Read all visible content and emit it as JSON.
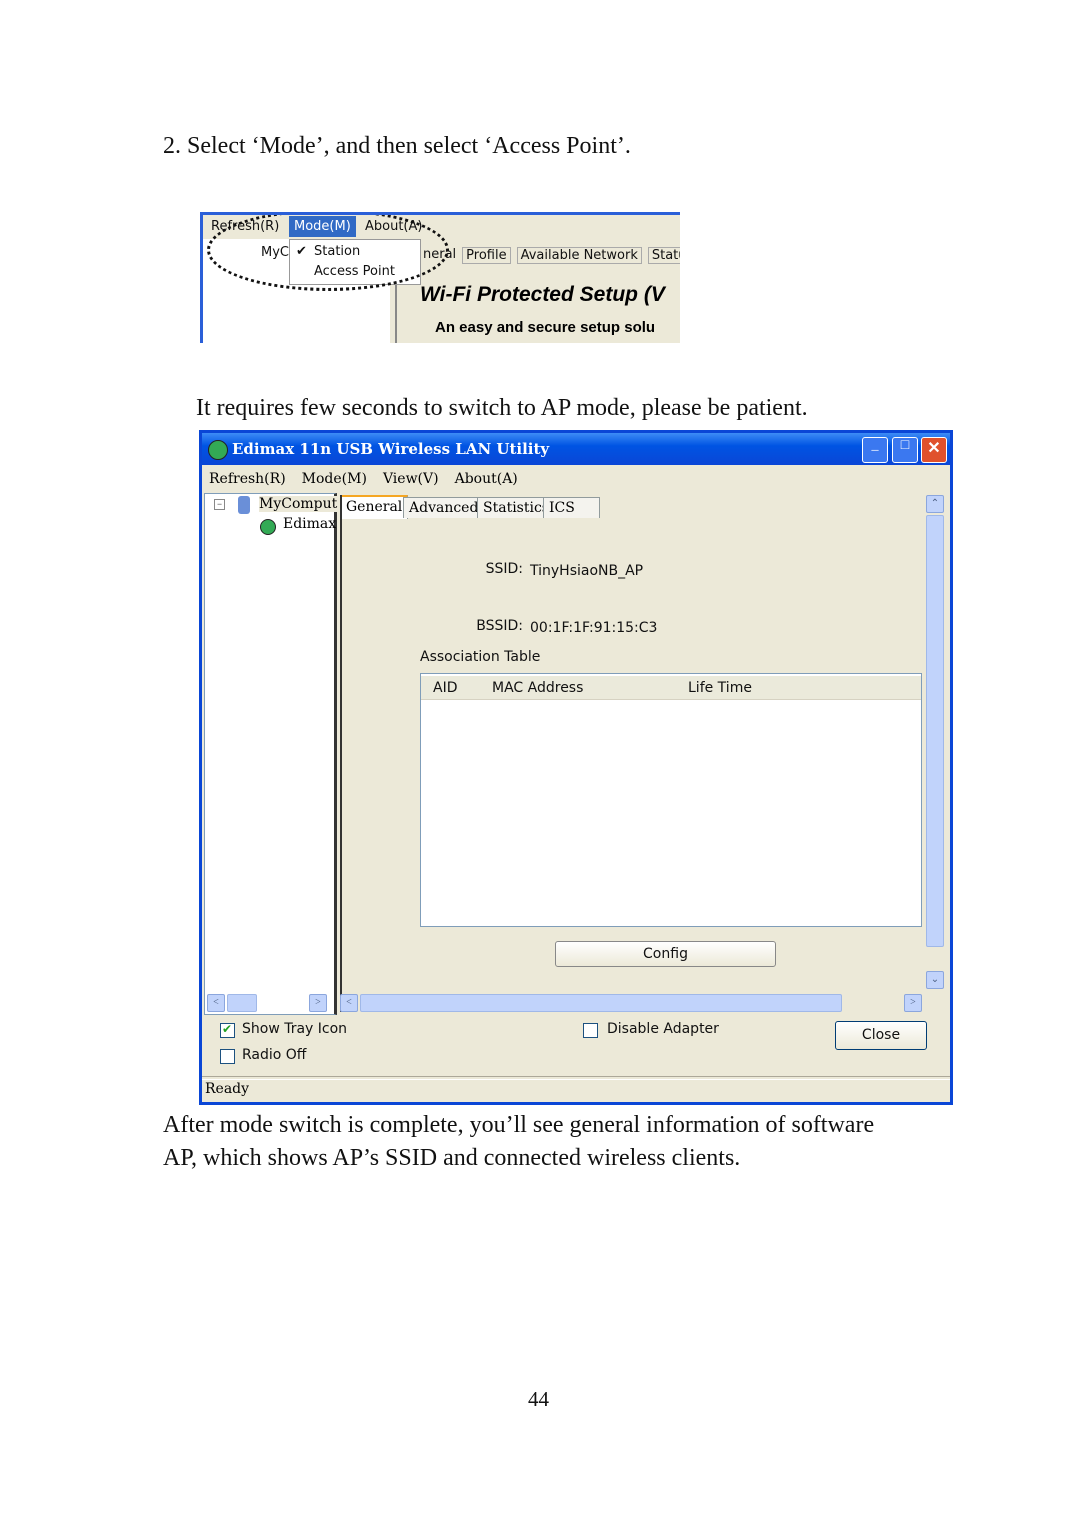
{
  "step": "2.  Select ‘Mode’, and then select ‘Access Point’.",
  "shot1": {
    "menu": [
      "Refresh(R)",
      "Mode(M)",
      "About(A)"
    ],
    "dropdown": [
      "Station",
      "Access Point"
    ],
    "tree_root": "MyC",
    "tabs": [
      "neral",
      "Profile",
      "Available Network",
      "Statu"
    ],
    "wps_title": "Wi-Fi Protected Setup (V",
    "wps_subtitle": "An easy and secure setup solu"
  },
  "note": "It requires few seconds to switch to AP mode, please be patient.",
  "window": {
    "title": "Edimax 11n USB Wireless LAN Utility",
    "menu": [
      "Refresh(R)",
      "Mode(M)",
      "View(V)",
      "About(A)"
    ],
    "tree": {
      "root": "MyComput",
      "child": "Edimax"
    },
    "tabs": [
      "General",
      "Advanced",
      "Statistics",
      "ICS"
    ],
    "ssid_label": "SSID:",
    "ssid": "TinyHsiaoNB_AP",
    "bssid_label": "BSSID:",
    "bssid": "00:1F:1F:91:15:C3",
    "assoc_label": "Association Table",
    "columns": [
      "AID",
      "MAC Address",
      "Life Time"
    ],
    "config": "Config",
    "show_tray": "Show Tray Icon",
    "show_tray_checked": true,
    "radio_off": "Radio Off",
    "radio_off_checked": false,
    "disable_adapter": "Disable Adapter",
    "disable_adapter_checked": false,
    "close": "Close",
    "status": "Ready"
  },
  "para": [
    "After mode switch is complete, you’ll see general information of software",
    "AP, which shows AP’s SSID and connected wireless clients."
  ],
  "page_number": "44"
}
